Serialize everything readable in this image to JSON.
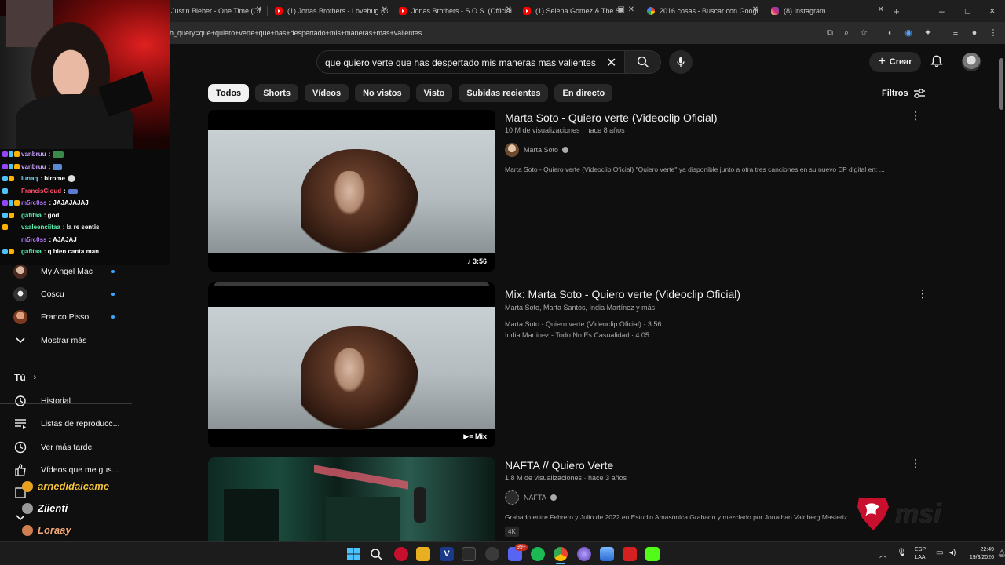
{
  "browser": {
    "tabs": [
      {
        "title": "Justin Bieber - One Time (Of",
        "favicon": "youtube-icon"
      },
      {
        "title": "(1) Jonas Brothers - Lovebug (O",
        "favicon": "youtube-icon"
      },
      {
        "title": "Jonas Brothers - S.O.S. (Official",
        "favicon": "youtube-icon"
      },
      {
        "title": "(1) Selena Gomez & The Sc",
        "favicon": "youtube-icon"
      },
      {
        "title": "2016 cosas - Buscar con Googl",
        "favicon": "google-icon"
      },
      {
        "title": "(8) Instagram",
        "favicon": "instagram-icon"
      }
    ],
    "new_tab": "+",
    "url": "h_query=que+quiero+verte+que+has+despertado+mis+maneras+mas+valientes"
  },
  "masthead": {
    "search_value": "que quiero verte que has despertado mis maneras mas valientes",
    "create_label": "Crear"
  },
  "chips": [
    "Todos",
    "Shorts",
    "Vídeos",
    "No vistos",
    "Visto",
    "Subidas recientes",
    "En directo"
  ],
  "filters_label": "Filtros",
  "results": [
    {
      "title": "Marta Soto - Quiero verte (Videoclip Oficial)",
      "meta": "10 M de visualizaciones · hace 8 años",
      "channel": "Marta Soto",
      "description": "Marta Soto - Quiero verte (Videoclip Oficial) \"Quiero verte\" ya disponible junto a otra tres canciones en su nuevo EP digital en: ...",
      "duration": "3:56"
    },
    {
      "title": "Mix: Marta Soto - Quiero verte (Videoclip Oficial)",
      "meta": "Marta Soto, Marta Santos, India Martínez y más",
      "track1": "Marta Soto - Quiero verte (Videoclip Oficial) · 3:56",
      "track2": "India Martinez - Todo No Es Casualidad · 4:05",
      "duration": "Mix"
    },
    {
      "title": "NAFTA // Quiero Verte",
      "meta": "1,8 M de visualizaciones · hace 3 años",
      "channel": "NAFTA",
      "description": "Grabado entre Febrero y Julio de 2022 en Estudio Amasónica Grabado y mezclado por Jonathan Vainberg Masteriz",
      "badge": "4K"
    }
  ],
  "sidebar": {
    "channels": [
      {
        "name": "My Angel Mac"
      },
      {
        "name": "Coscu"
      },
      {
        "name": "Franco Pisso"
      }
    ],
    "show_more": "Mostrar más",
    "you_heading": "Tú",
    "you_items": [
      "Historial",
      "Listas de reproducc...",
      "Ver más tarde",
      "Vídeos que me gus..."
    ]
  },
  "chat": [
    {
      "user": "vanbruu",
      "msg": ":",
      "color": "#c9a0ff"
    },
    {
      "user": "vanbruu",
      "msg": ":",
      "color": "#c9a0ff"
    },
    {
      "user": "lunaq",
      "msg": ": birome",
      "color": "#7dd8ff"
    },
    {
      "user": "FrancisCloud",
      "msg": ":",
      "color": "#ff4d6d"
    },
    {
      "user": "m5rc0ss",
      "msg": ": JAJAJAJAJ",
      "color": "#b57cff"
    },
    {
      "user": "gafitaa",
      "msg": ": god",
      "color": "#59f0b0"
    },
    {
      "user": "vaaleenciitaa",
      "msg": ": la re sentis",
      "color": "#59f0b0"
    },
    {
      "user": "m5rc0ss",
      "msg": ": AJAJAJ",
      "color": "#b57cff"
    },
    {
      "user": "gafitaa",
      "msg": ": q bien canta man",
      "color": "#59f0b0"
    }
  ],
  "alerts": [
    "arnedidaicame",
    "Ziienti",
    "Loraay"
  ],
  "taskbar": {
    "lang1": "ESP",
    "lang2": "LAA",
    "time": "22:49",
    "date": "19/3/2026",
    "spotify_badge": "99+"
  }
}
